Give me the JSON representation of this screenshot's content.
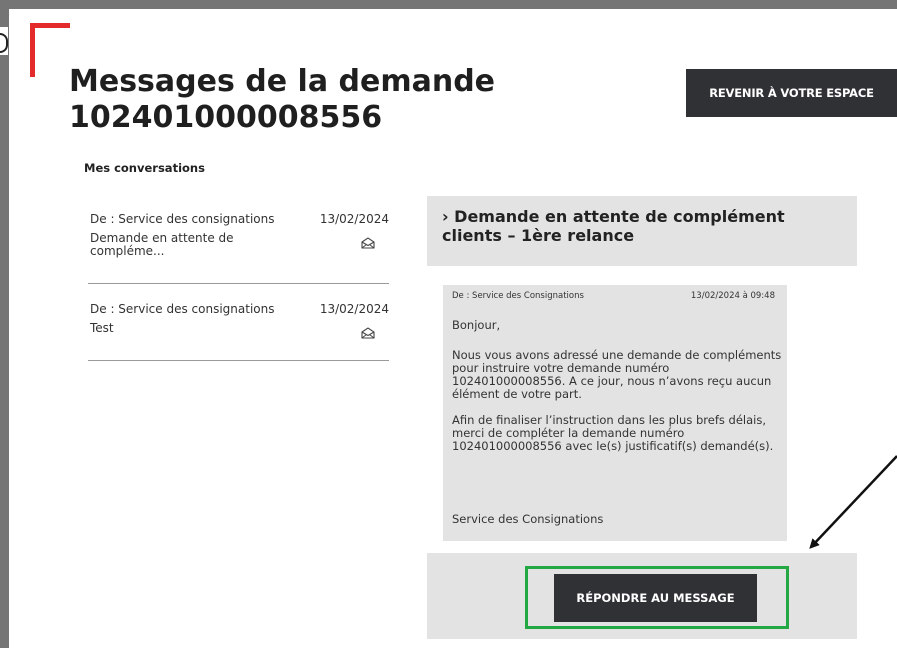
{
  "header": {
    "title": "Messages de la demande 102401000008556",
    "back_button": "REVENIR À VOTRE ESPACE"
  },
  "conversations": {
    "heading": "Mes conversations",
    "items": [
      {
        "from": "De : Service des consignations",
        "date": "13/02/2024",
        "subject": "Demande en attente de compléme...",
        "icon": "envelope-open-icon"
      },
      {
        "from": "De : Service des consignations",
        "date": "13/02/2024",
        "subject": "Test",
        "icon": "envelope-open-icon"
      }
    ]
  },
  "thread": {
    "title": "› Demande en attente de complément clients – 1ère relance",
    "message": {
      "from": "De : Service des Consignations",
      "datetime": "13/02/2024 à 09:48",
      "greeting": "Bonjour,",
      "paragraph1": "Nous vous avons adressé une demande de compléments pour instruire votre demande numéro 102401000008556. A ce jour, nous n’avons reçu aucun élément de votre part.",
      "paragraph2": "Afin de finaliser l’instruction dans les plus brefs délais, merci de compléter la demande numéro 102401000008556 avec le(s) justificatif(s) demandé(s).",
      "signature": "Service des Consignations"
    },
    "reply_button": "RÉPONDRE AU MESSAGE"
  },
  "colors": {
    "brand_red": "#e42b2b",
    "dark_button": "#2f3135",
    "highlight_green": "#24a844",
    "panel_gray": "#e3e3e3"
  }
}
